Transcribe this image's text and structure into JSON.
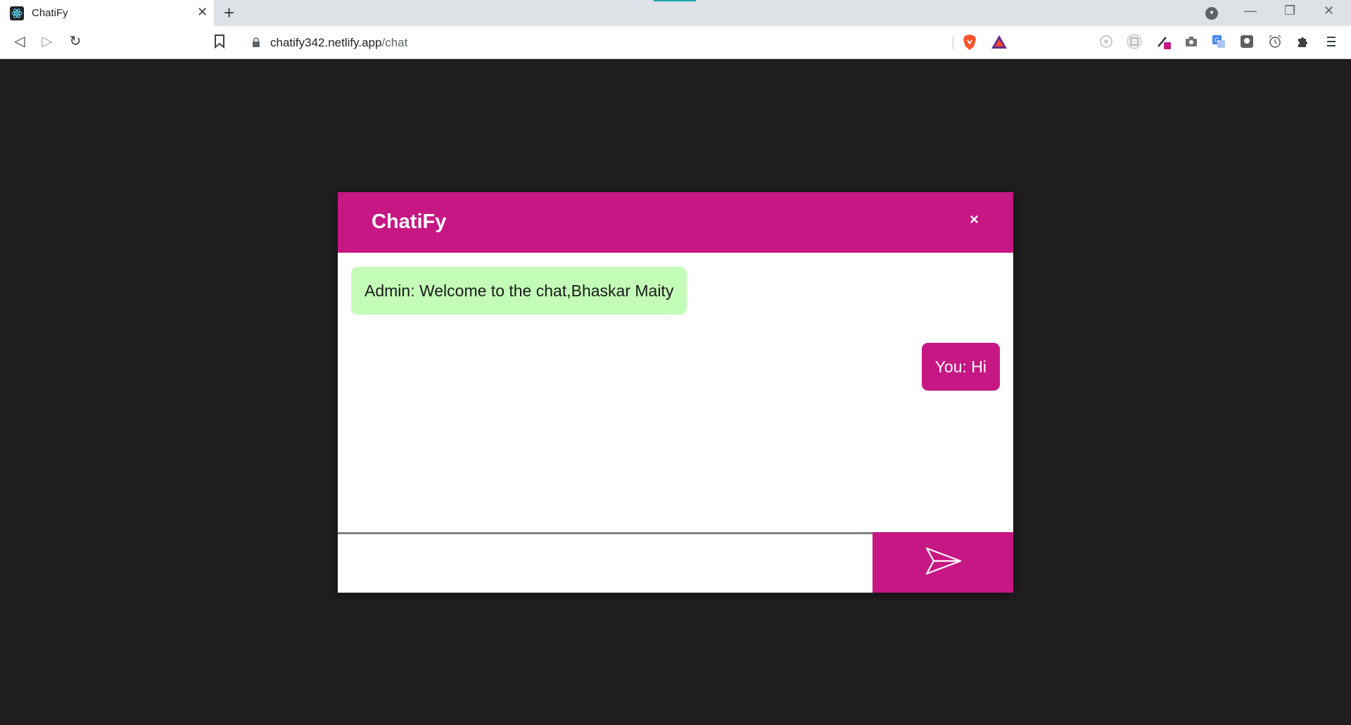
{
  "browser": {
    "tab_title": "ChatiFy",
    "tab_close": "✕",
    "new_tab": "+",
    "url_host": "chatify342.netlify.app",
    "url_path": "/chat",
    "nav_back": "◁",
    "nav_forward": "▷",
    "nav_reload": "↻",
    "window_min": "—",
    "window_restore": "❐",
    "window_close": "✕",
    "icons": [
      "react-favicon-icon",
      "bookmark-icon",
      "lock-icon",
      "brave-shields-icon",
      "brave-rewards-icon",
      "extension-icons",
      "puzzle-icon",
      "menu-icon"
    ]
  },
  "chat": {
    "title": "ChatiFy",
    "close_label": "×",
    "messages": [
      {
        "sender": "admin",
        "text": "Admin: Welcome to the chat,Bhaskar Maity"
      },
      {
        "sender": "you",
        "text": "You: Hi"
      }
    ],
    "input_value": "",
    "input_placeholder": "",
    "send_icon": "send-icon"
  },
  "colors": {
    "accent": "#c61784",
    "admin_bubble": "#c4fdb8",
    "page_background": "#201e1f"
  }
}
